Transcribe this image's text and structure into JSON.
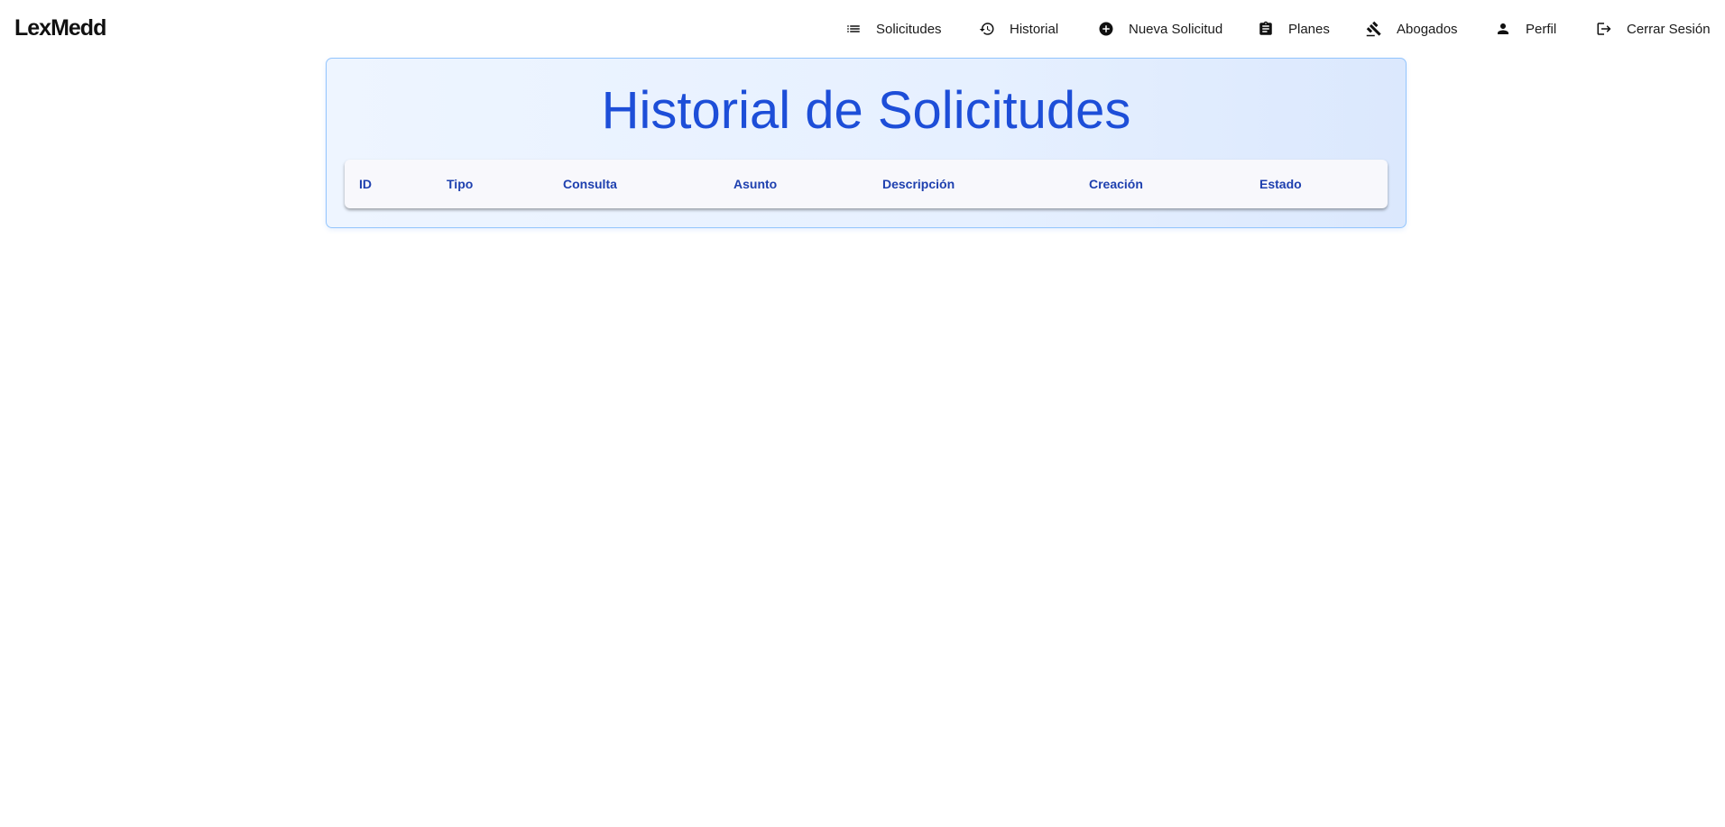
{
  "app": {
    "brand": "LexMedd"
  },
  "nav": {
    "items": [
      {
        "label": "Solicitudes",
        "icon": "list-icon"
      },
      {
        "label": "Historial",
        "icon": "history-icon"
      },
      {
        "label": "Nueva Solicitud",
        "icon": "add-circle-icon"
      },
      {
        "label": "Planes",
        "icon": "clipboard-icon"
      },
      {
        "label": "Abogados",
        "icon": "gavel-icon"
      },
      {
        "label": "Perfil",
        "icon": "person-icon"
      },
      {
        "label": "Cerrar Sesión",
        "icon": "logout-icon"
      }
    ]
  },
  "main": {
    "title": "Historial de Solicitudes",
    "table": {
      "columns": [
        "ID",
        "Tipo",
        "Consulta",
        "Asunto",
        "Descripción",
        "Creación",
        "Estado"
      ],
      "rows": []
    }
  },
  "colors": {
    "accent": "#1d4ed8",
    "header_text": "#1e40af",
    "card_border": "#93c5fd"
  }
}
